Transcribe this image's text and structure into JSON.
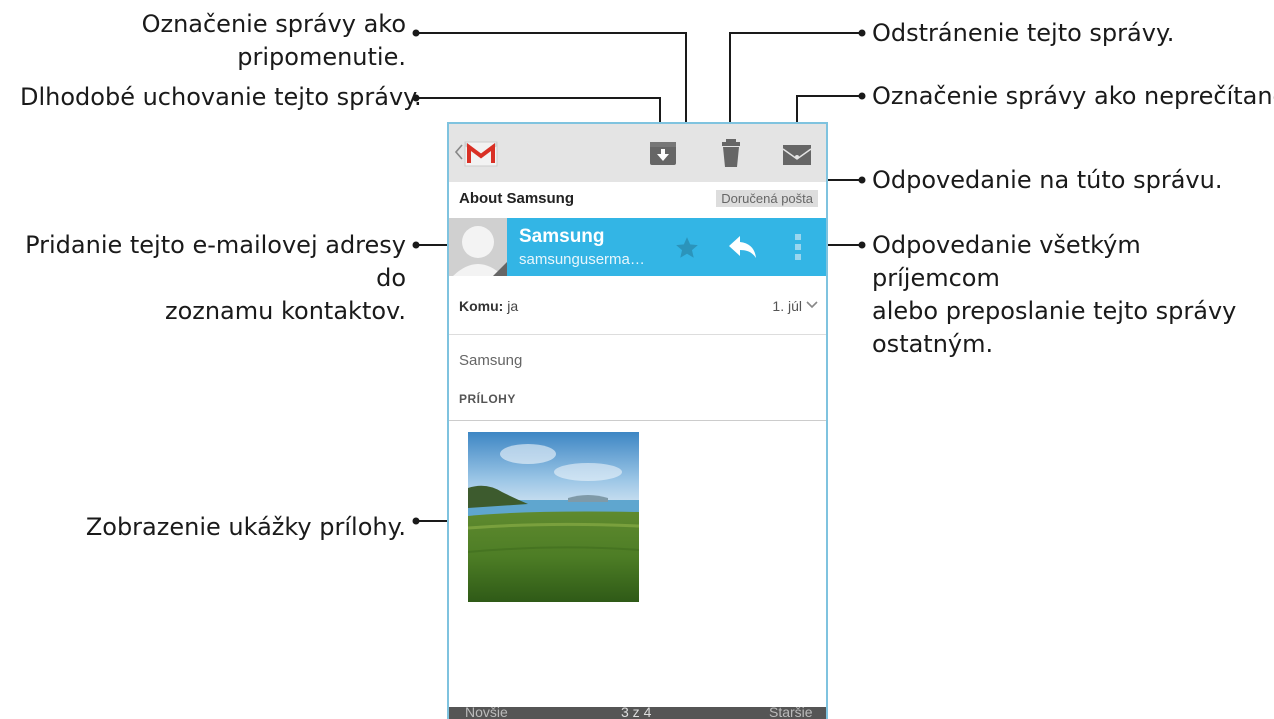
{
  "callouts": {
    "mark_reminder": "Označenie správy ako\npripomenutie.",
    "archive": "Dlhodobé uchovanie tejto správy.",
    "add_contact": "Pridanie tejto e-mailovej adresy do\nzoznamu kontaktov.",
    "preview_attachment": "Zobrazenie ukážky prílohy.",
    "delete": "Odstránenie tejto správy.",
    "mark_unread": "Označenie správy ako neprečítanej.",
    "reply": "Odpovedanie na túto správu.",
    "reply_all_forward": "Odpovedanie všetkým príjemcom\nalebo preposlanie tejto správy\nostatným."
  },
  "email": {
    "subject": "About Samsung",
    "label": "Doručená pošta",
    "sender_name": "Samsung",
    "sender_email": "samsunguserma…",
    "to_label": "Komu:",
    "to_value": "ja",
    "date": "1. júl",
    "body": "Samsung",
    "attachments_header": "PRÍLOHY"
  },
  "footer": {
    "newer": "Novšie",
    "position": "3 z 4",
    "older": "Staršie"
  },
  "colors": {
    "accent": "#33b5e5",
    "callout_line": "#1a1a1a"
  },
  "icons": [
    "back-chevron-icon",
    "gmail-icon",
    "archive-icon",
    "trash-icon",
    "mark-unread-icon",
    "star-icon",
    "reply-icon",
    "overflow-menu-icon",
    "avatar-icon",
    "chevron-down-icon"
  ]
}
